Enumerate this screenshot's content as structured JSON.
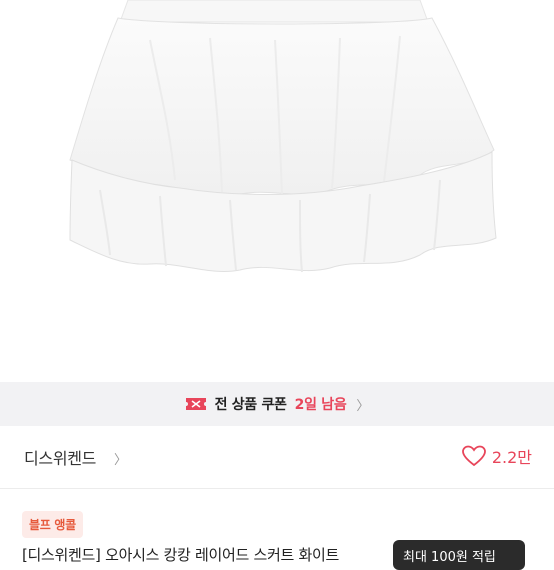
{
  "coupon": {
    "label": "전 상품 쿠폰",
    "days_left": "2일 남음"
  },
  "shop": {
    "name": "디스위켄드",
    "likes": "2.2만"
  },
  "badge": {
    "label": "블프 앵콜"
  },
  "product": {
    "title_partial": "[디스위켄드] 오아시스 캉캉 레이어드 스커트 화이트"
  },
  "tooltip": {
    "text": "최대 100원 적립"
  },
  "colors": {
    "accent": "#e8455a",
    "coupon_bg": "#f2f2f4",
    "badge_bg": "#fdebe8"
  }
}
